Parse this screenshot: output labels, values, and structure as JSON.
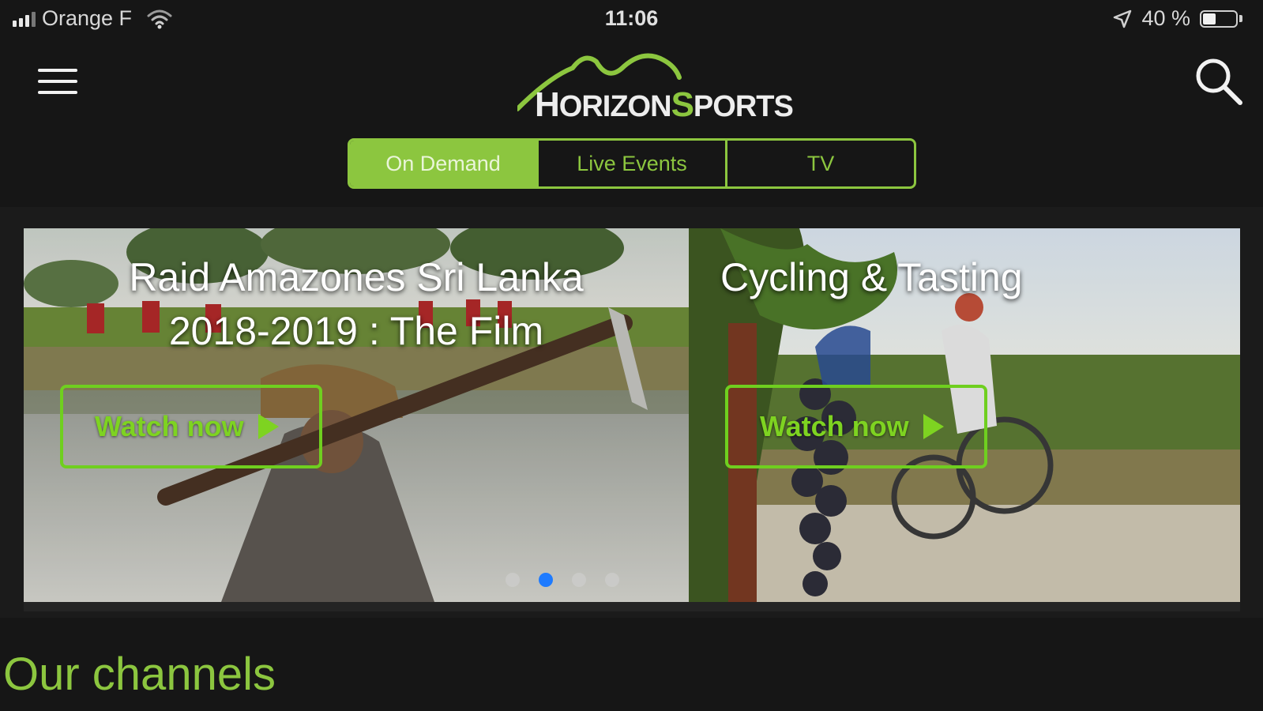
{
  "status_bar": {
    "carrier": "Orange F",
    "time": "11:06",
    "battery_percent": "40 %",
    "battery_level": 0.4,
    "icons": [
      "signal-icon",
      "wifi-icon",
      "location-arrow-icon",
      "battery-icon"
    ]
  },
  "header": {
    "logo_text_1": "H",
    "logo_text_2": "ORIZON",
    "logo_text_3": "S",
    "logo_text_4": "PORTS",
    "menu_icon": "hamburger-menu-icon",
    "search_icon": "search-icon"
  },
  "tabs": [
    {
      "label": "On Demand",
      "active": true
    },
    {
      "label": "Live Events",
      "active": false
    },
    {
      "label": "TV",
      "active": false
    }
  ],
  "carousel": {
    "cards": [
      {
        "title_line1": "Raid Amazones Sri Lanka",
        "title_line2": "2018-2019 : The Film",
        "button": "Watch now"
      },
      {
        "title_line1": "Cycling & Tasting",
        "button": "Watch now"
      }
    ],
    "dot_count": 4,
    "active_dot_index": 1
  },
  "sections": {
    "channels_title": "Our channels"
  },
  "colors": {
    "accent": "#8cc63f",
    "background": "#161616",
    "active_dot": "#1e7bff"
  }
}
